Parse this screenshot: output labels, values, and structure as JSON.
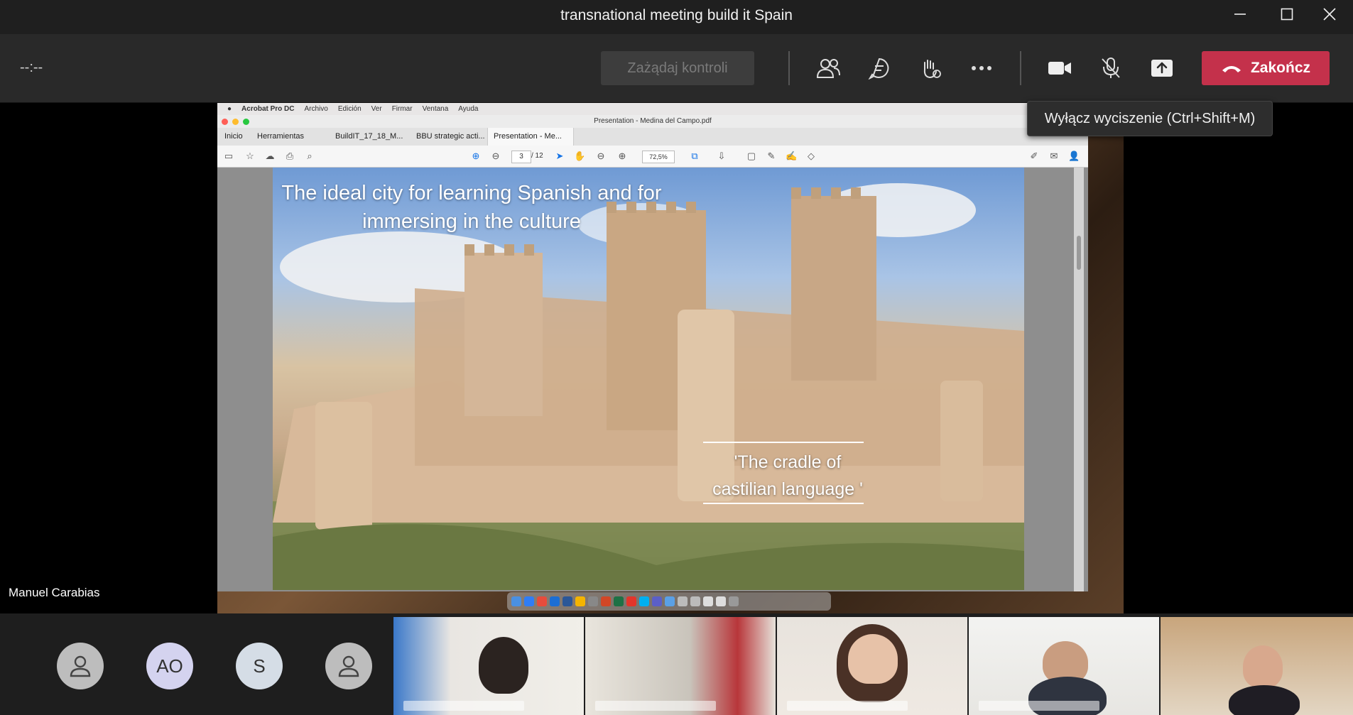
{
  "window": {
    "title": "transnational meeting build it Spain"
  },
  "controls": {
    "timer": "--:--",
    "request_control_label": "Zażądaj kontroli",
    "end_call_label": "Zakończ",
    "tooltip": "Wyłącz wyciszenie (Ctrl+Shift+M)",
    "accent_end_color": "#c4314b"
  },
  "shared_screen": {
    "mac_menu": [
      "Acrobat Pro DC",
      "Archivo",
      "Edición",
      "Ver",
      "Firmar",
      "Ventana",
      "Ayuda"
    ],
    "window_title": "Presentation - Medina del Campo.pdf",
    "tabs": [
      "Inicio",
      "Herramientas",
      "BuildIT_17_18_M...",
      "BBU strategic acti...",
      "Presentation - Me..."
    ],
    "tab_close": "×",
    "page_current": "3",
    "page_total": "/ 12",
    "zoom": "72,5%",
    "slide": {
      "title_line1": "The ideal city for learning Spanish and for",
      "title_line2": "immersing in the culture",
      "quote_line1": "'The cradle of",
      "quote_line2": "castilian language '"
    }
  },
  "speaker_name": "Manuel Carabias",
  "participants": {
    "avatars": [
      {
        "initials": "",
        "icon": "person-icon"
      },
      {
        "initials": "AO"
      },
      {
        "initials": "S"
      },
      {
        "initials": "",
        "icon": "person-icon"
      }
    ],
    "video_tiles": 5
  }
}
